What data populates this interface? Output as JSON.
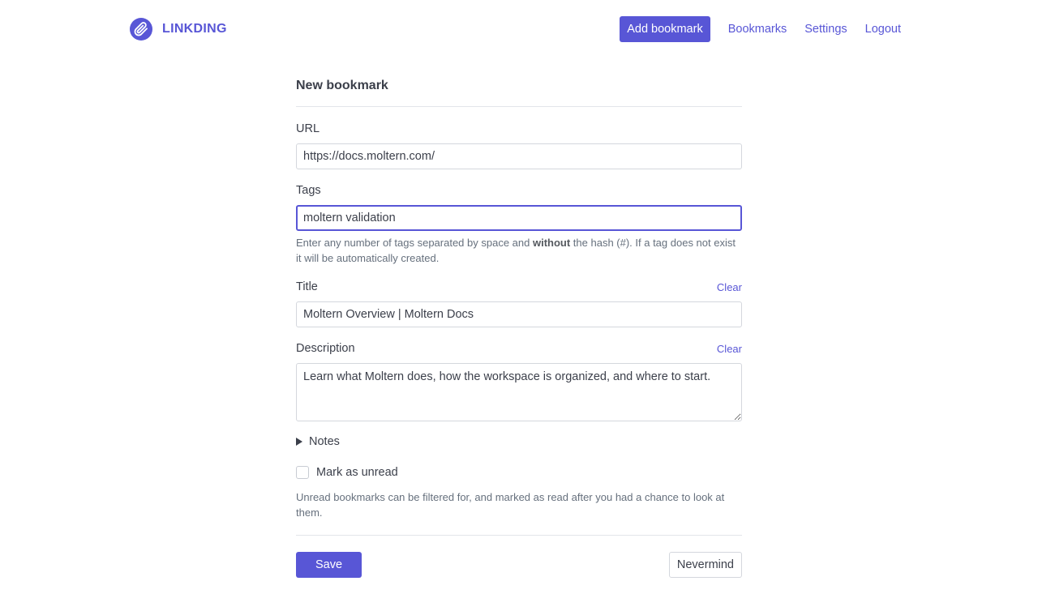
{
  "header": {
    "brand": "LINKDING",
    "nav": {
      "add_bookmark": "Add bookmark",
      "bookmarks": "Bookmarks",
      "settings": "Settings",
      "logout": "Logout"
    }
  },
  "form": {
    "title": "New bookmark",
    "url": {
      "label": "URL",
      "value": "https://docs.moltern.com/"
    },
    "tags": {
      "label": "Tags",
      "value": "moltern validation",
      "help_before": "Enter any number of tags separated by space and ",
      "help_bold": "without",
      "help_after": " the hash (#). If a tag does not exist it will be automatically created."
    },
    "title_field": {
      "label": "Title",
      "clear": "Clear",
      "value": "Moltern Overview | Moltern Docs"
    },
    "description": {
      "label": "Description",
      "clear": "Clear",
      "value": "Learn what Moltern does, how the workspace is organized, and where to start."
    },
    "notes": {
      "label": "Notes"
    },
    "unread": {
      "label": "Mark as unread",
      "checked": false,
      "help": "Unread bookmarks can be filtered for, and marked as read after you had a chance to look at them."
    },
    "save": "Save",
    "cancel": "Nevermind"
  },
  "colors": {
    "accent": "#5856d6",
    "text": "#3b3f4a",
    "muted": "#66707d",
    "border": "#d4d7dd"
  },
  "icons": {
    "logo": "paperclip-icon",
    "notes_toggle": "triangle-right-icon"
  }
}
